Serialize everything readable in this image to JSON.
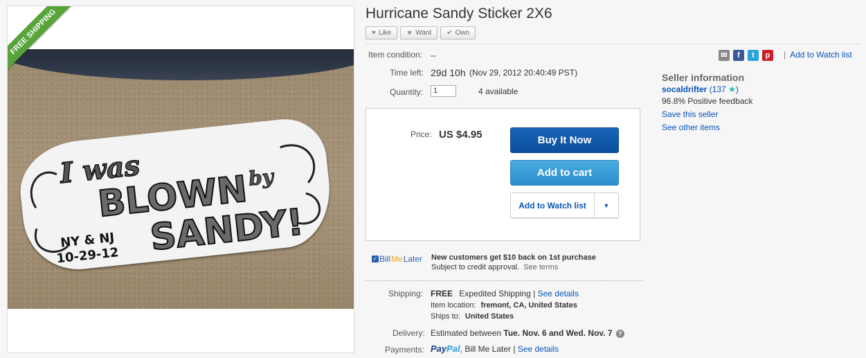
{
  "listing": {
    "title": "Hurricane Sandy Sticker 2X6",
    "badge": "FREE SHIPPING",
    "image_text": {
      "line1": "I was",
      "line2": "BLOWN",
      "by": "by",
      "line3": "SANDY!",
      "location": "NY & NJ",
      "date": "10-29-12"
    }
  },
  "social": {
    "like_label": "Like",
    "want_label": "Want",
    "own_label": "Own"
  },
  "details": {
    "condition_label": "Item condition:",
    "condition_value": "--",
    "time_left_label": "Time left:",
    "time_left_value": "29d 10h",
    "time_left_date": "(Nov 29, 2012  20:40:49 PST)",
    "quantity_label": "Quantity:",
    "quantity_value": "1",
    "available": "4 available"
  },
  "purchase": {
    "price_label": "Price:",
    "price_value": "US $4.95",
    "buy_now_label": "Buy It Now",
    "add_cart_label": "Add to cart",
    "watch_label": "Add to Watch list"
  },
  "billmelater": {
    "logo_bill": "Bill",
    "logo_me": "Me",
    "logo_later": "Later",
    "headline": "New customers get $10 back on 1st purchase",
    "sub": "Subject to credit approval.",
    "terms": "See terms"
  },
  "shipping": {
    "label": "Shipping:",
    "free": "FREE",
    "method": "Expedited Shipping |",
    "details_link": "See details",
    "location_label": "Item location:",
    "location_value": "fremont, CA, United States",
    "ships_to_label": "Ships to:",
    "ships_to_value": "United States"
  },
  "delivery": {
    "label": "Delivery:",
    "prefix": "Estimated between",
    "range": "Tue. Nov. 6 and Wed. Nov. 7"
  },
  "payments": {
    "label": "Payments:",
    "paypal_pay": "Pay",
    "paypal_pal": "Pal",
    "others": ", Bill Me Later |",
    "details_link": "See details"
  },
  "sidebar": {
    "watch_link": "Add to Watch list",
    "seller_title": "Seller information",
    "seller_name": "socaldrifter",
    "feedback_score": "(137",
    "feedback_close": ")",
    "positive": "96.8% Positive feedback",
    "save_seller": "Save this seller",
    "other_items": "See other items"
  },
  "colors": {
    "buy_button": "#0a4f9e",
    "cart_button": "#2c8fcf",
    "ribbon": "#57a43b",
    "link": "#0654ba"
  },
  "icons": [
    "heart-icon",
    "star-icon",
    "check-icon",
    "mail-icon",
    "facebook-icon",
    "twitter-icon",
    "pinterest-icon",
    "chevron-down-icon",
    "help-icon"
  ]
}
